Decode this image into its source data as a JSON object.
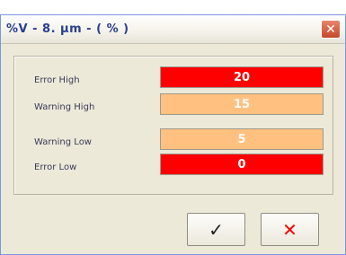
{
  "window": {
    "title": "%V - 8. µm - ( % )",
    "close_glyph": "✕"
  },
  "fields": [
    {
      "label": "Error High",
      "value": "20",
      "status": "error"
    },
    {
      "label": "Warning High",
      "value": "15",
      "status": "warning"
    },
    {
      "label": "Warning Low",
      "value": "5",
      "status": "warning"
    },
    {
      "label": "Error Low",
      "value": "0",
      "status": "error"
    }
  ],
  "buttons": {
    "ok_glyph": "✓",
    "cancel_glyph": "✕"
  },
  "colors": {
    "error": "#ff0000",
    "warning": "#ffc080",
    "cancel_icon": "#ff0000"
  }
}
